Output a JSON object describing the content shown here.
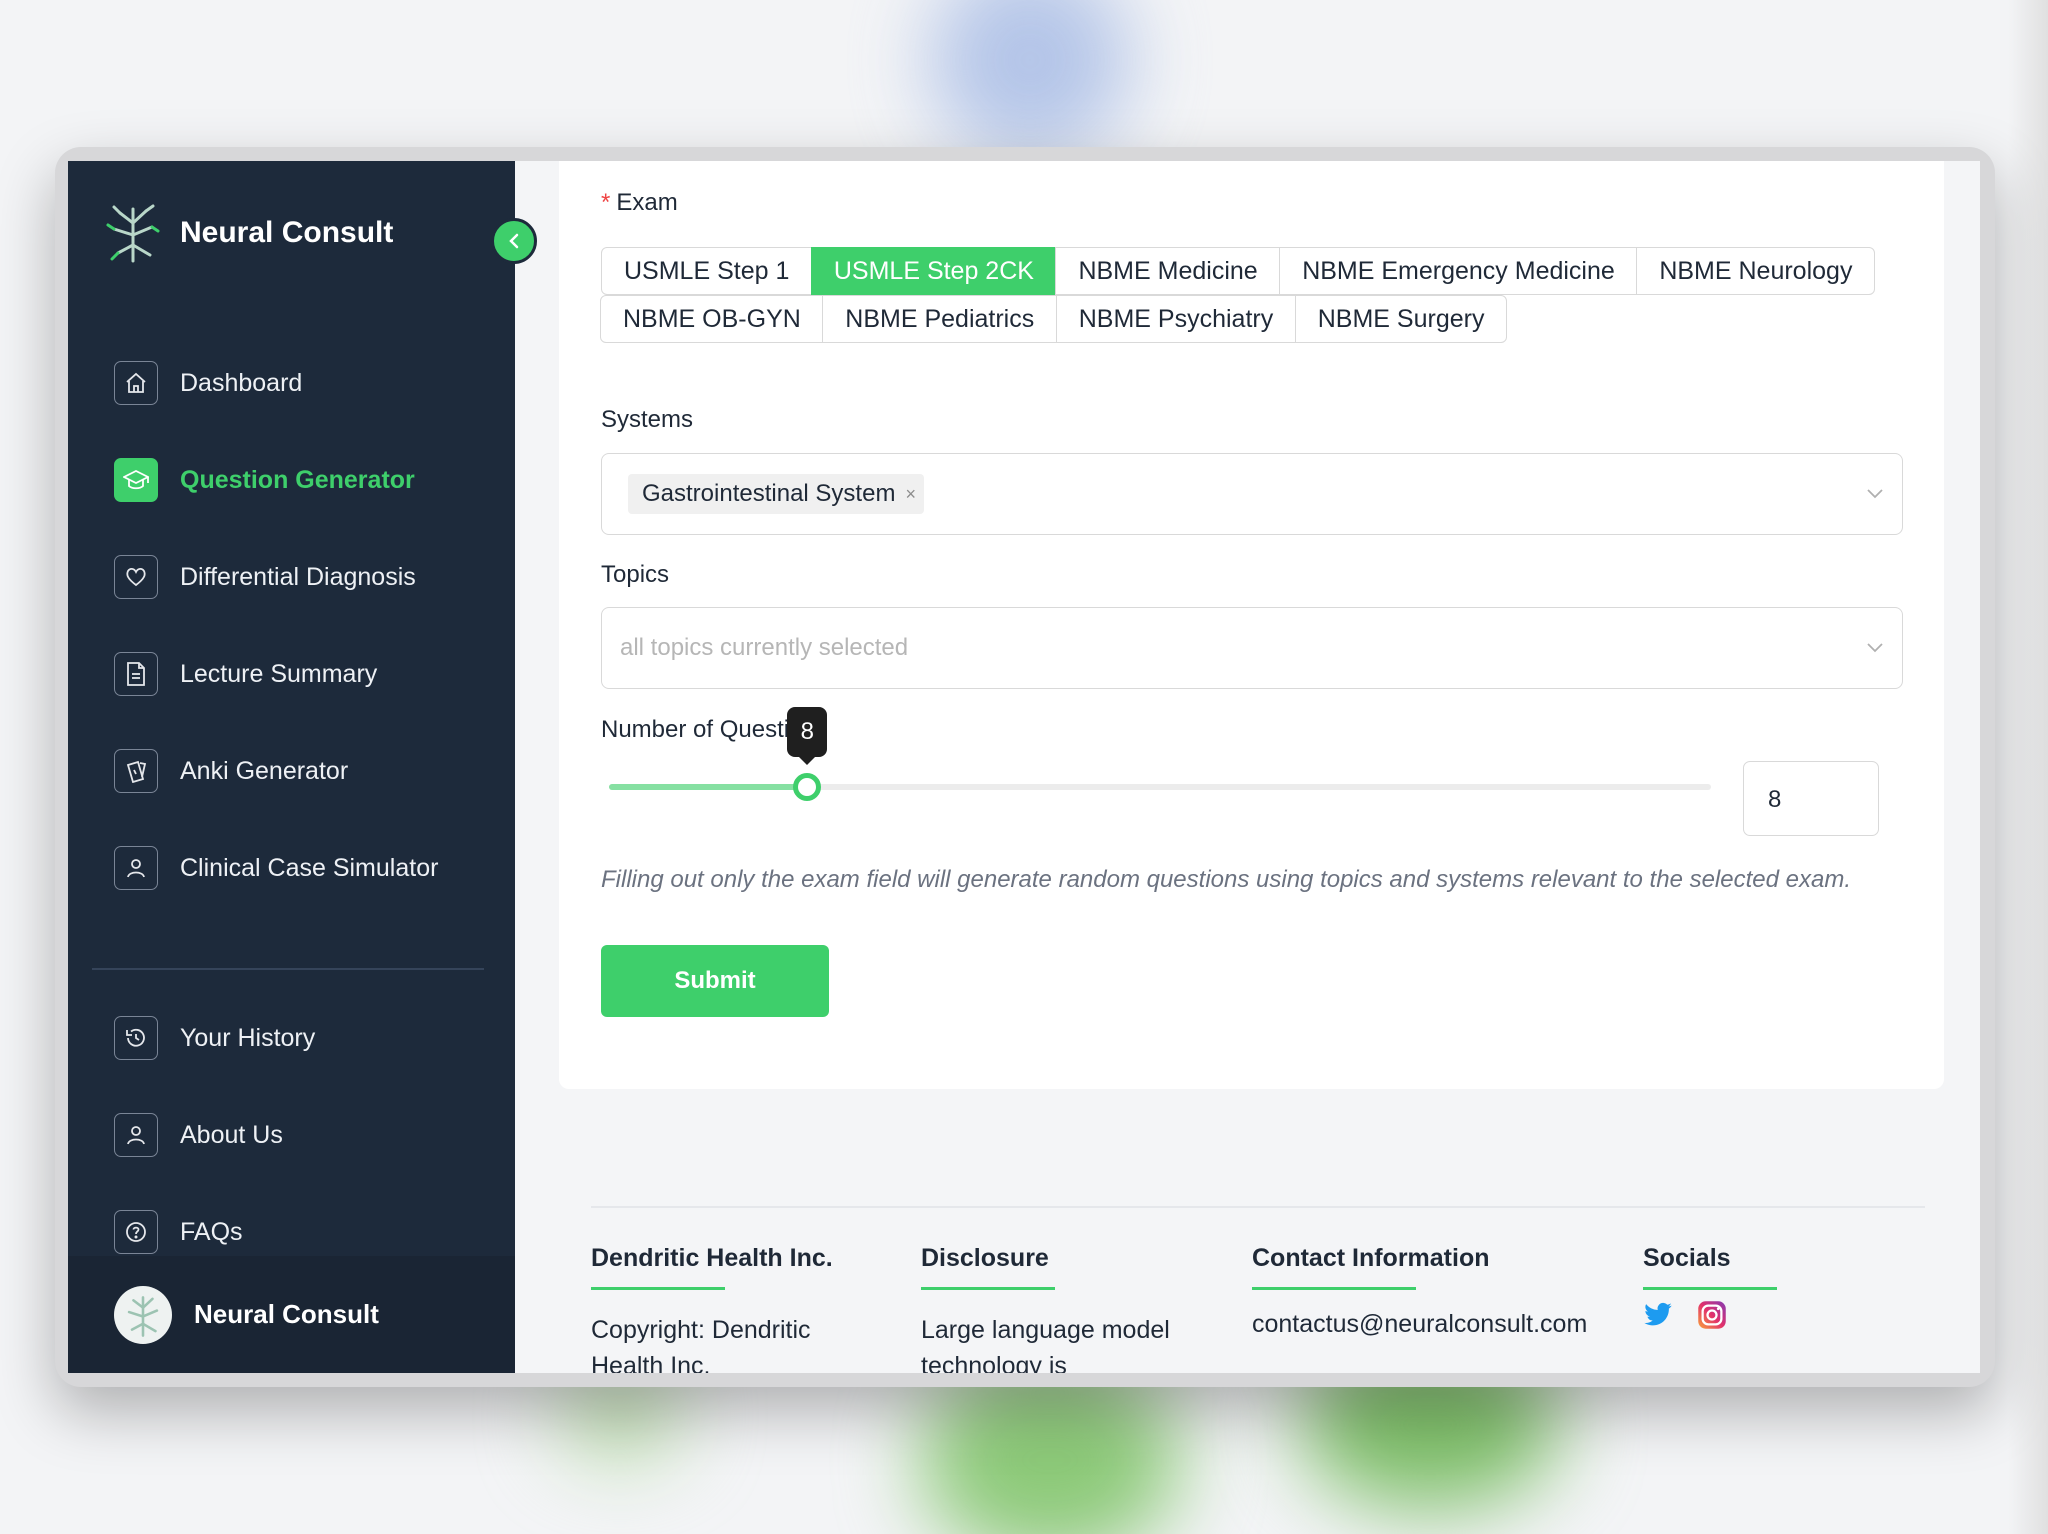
{
  "app": {
    "brand_name": "Neural Consult",
    "accent_color": "#3ecf6b",
    "sidebar_color": "#1d2a3b"
  },
  "sidebar": {
    "collapse_icon": "chevron-left-icon",
    "nav_items": [
      {
        "label": "Dashboard",
        "icon": "home-icon",
        "active": false
      },
      {
        "label": "Question Generator",
        "icon": "graduation-cap-icon",
        "active": true
      },
      {
        "label": "Differential Diagnosis",
        "icon": "heart-icon",
        "active": false
      },
      {
        "label": "Lecture Summary",
        "icon": "document-icon",
        "active": false
      },
      {
        "label": "Anki Generator",
        "icon": "cards-icon",
        "active": false
      },
      {
        "label": "Clinical Case Simulator",
        "icon": "user-icon",
        "active": false
      }
    ],
    "secondary_items": [
      {
        "label": "Your History",
        "icon": "history-icon"
      },
      {
        "label": "About Us",
        "icon": "user-icon"
      },
      {
        "label": "FAQs",
        "icon": "question-circle-icon"
      }
    ],
    "footer_brand": "Neural Consult"
  },
  "form": {
    "exam_label": "Exam",
    "exam_required_mark": "*",
    "exam_options_row1": [
      "USMLE Step 1",
      "USMLE Step 2CK",
      "NBME Medicine",
      "NBME Emergency Medicine",
      "NBME Neurology"
    ],
    "exam_options_row2": [
      "NBME OB-GYN",
      "NBME Pediatrics",
      "NBME Psychiatry",
      "NBME Surgery"
    ],
    "exam_selected": "USMLE Step 2CK",
    "systems_label": "Systems",
    "systems_selected": [
      "Gastrointestinal System"
    ],
    "systems_remove_glyph": "×",
    "topics_label": "Topics",
    "topics_placeholder": "all topics currently selected",
    "num_questions_label": "Number of Questions",
    "num_questions_value": "8",
    "slider_fraction": 0.18,
    "hint": "Filling out only the exam field will generate random questions using topics and systems relevant to the selected exam.",
    "submit_label": "Submit"
  },
  "footer": {
    "company_heading": "Dendritic Health Inc.",
    "company_text": "Copyright: Dendritic Health Inc.",
    "disclosure_heading": "Disclosure",
    "disclosure_text": "Large language model technology is",
    "contact_heading": "Contact Information",
    "contact_email": "contactus@neuralconsult.com",
    "socials_heading": "Socials",
    "socials": [
      {
        "name": "Twitter",
        "icon": "twitter-icon",
        "color": "#1d9bf0"
      },
      {
        "name": "Instagram",
        "icon": "instagram-icon",
        "color": "#e1306c"
      }
    ]
  }
}
